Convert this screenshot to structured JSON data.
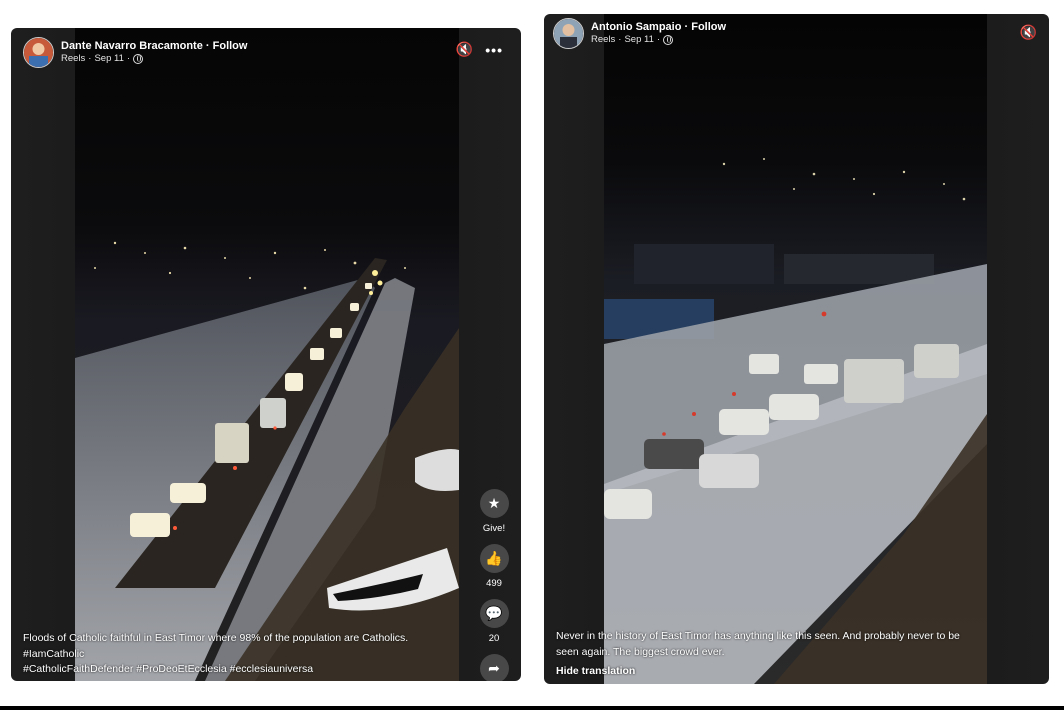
{
  "posts": [
    {
      "author": "Dante Navarro Bracamonte",
      "follow": "Follow",
      "section": "Reels",
      "date": "Sep 11",
      "caption_lines": [
        "Floods of Catholic faithful in East Timor where 98% of the population are Catholics.",
        "#IamCatholic",
        "#CatholicFaithDefender #ProDeoEtEcclesia #ecclesiauniversa"
      ],
      "actions": {
        "give_label": "Give!",
        "likes": "499",
        "comments": "20"
      },
      "icons": [
        "mute-icon",
        "more-options-icon",
        "star-icon",
        "thumbs-up-icon",
        "comment-icon",
        "share-icon"
      ]
    },
    {
      "author": "Antonio Sampaio",
      "follow": "Follow",
      "section": "Reels",
      "date": "Sep 11",
      "caption_lines": [
        "Never in the history of East Timor has anything like this seen. And probably never to be",
        "seen again. The biggest crowd ever."
      ],
      "hide_translation": "Hide translation",
      "icons": [
        "mute-icon"
      ]
    }
  ],
  "separator": " · "
}
